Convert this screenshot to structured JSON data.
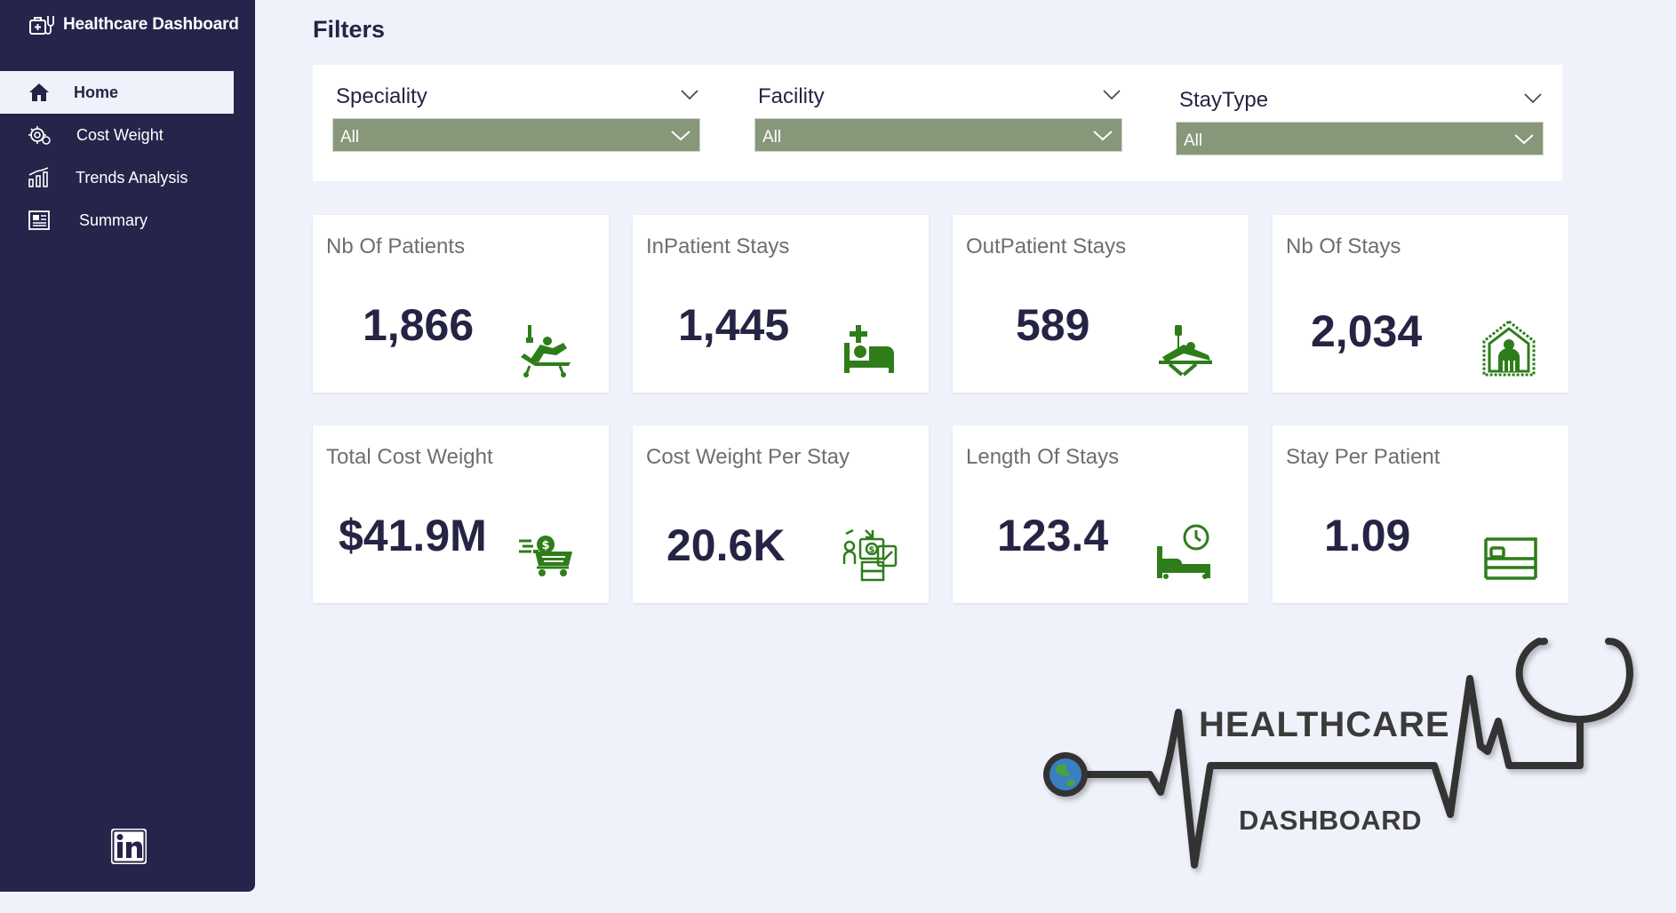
{
  "app": {
    "title": "Healthcare Dashboard"
  },
  "sidebar": {
    "items": [
      {
        "label": "Home",
        "icon": "home-icon",
        "active": true
      },
      {
        "label": "Cost Weight",
        "icon": "cost-weight-icon",
        "active": false
      },
      {
        "label": "Trends Analysis",
        "icon": "trends-chart-icon",
        "active": false
      },
      {
        "label": "Summary",
        "icon": "summary-report-icon",
        "active": false
      }
    ],
    "footer_icon": "linkedin-icon"
  },
  "filters": {
    "title": "Filters",
    "items": [
      {
        "label": "Speciality",
        "value": "All"
      },
      {
        "label": "Facility",
        "value": "All"
      },
      {
        "label": "StayType",
        "value": "All"
      }
    ]
  },
  "kpis": [
    {
      "title": "Nb Of Patients",
      "value": "1,866",
      "icon": "patient-recliner-icon"
    },
    {
      "title": "InPatient Stays",
      "value": "1,445",
      "icon": "hospital-bed-icon"
    },
    {
      "title": "OutPatient Stays",
      "value": "589",
      "icon": "iv-drip-patient-icon"
    },
    {
      "title": "Nb Of Stays",
      "value": "2,034",
      "icon": "home-care-icon"
    },
    {
      "title": "Total Cost Weight",
      "value": "$41.9M",
      "icon": "cost-cart-icon"
    },
    {
      "title": "Cost Weight Per Stay",
      "value": "20.6K",
      "icon": "money-documents-icon"
    },
    {
      "title": "Length Of Stays",
      "value": "123.4",
      "icon": "bed-clock-icon"
    },
    {
      "title": "Stay Per Patient",
      "value": "1.09",
      "icon": "bed-outline-icon"
    }
  ],
  "logo": {
    "line1": "HEALTHCARE",
    "line2": "DASHBOARD"
  },
  "colors": {
    "sidebar": "#26244a",
    "background": "#eff2fa",
    "accent_green": "#2e7d1a",
    "filter_fill": "#87977a",
    "kpi_text": "#252444"
  }
}
